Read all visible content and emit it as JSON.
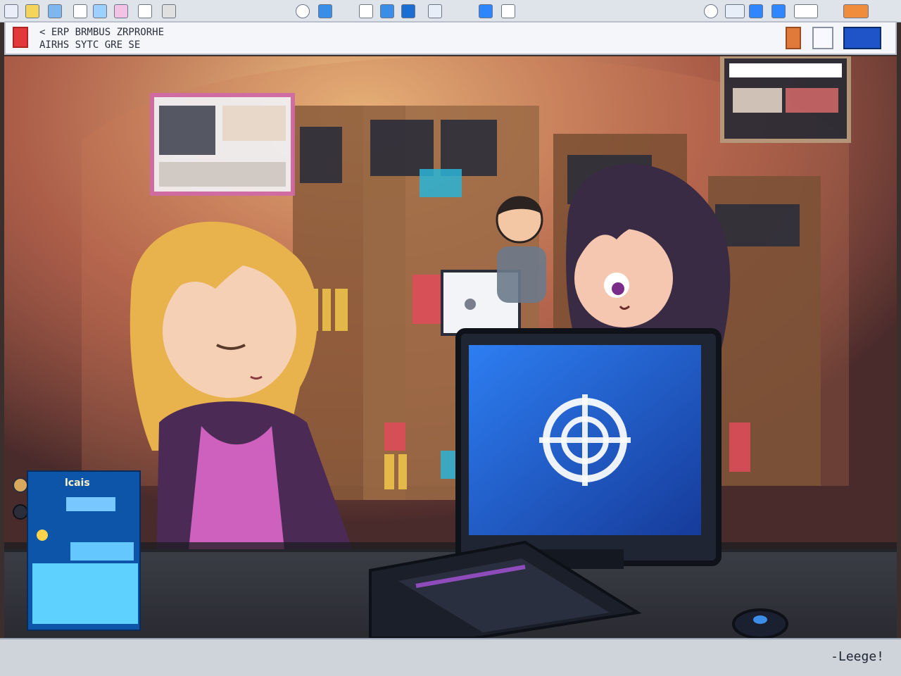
{
  "topbar": {
    "left_icons": [
      "app-icon",
      "folder-icon",
      "image-icon",
      "flag-icon",
      "chart-icon",
      "text-icon",
      "calendar-icon",
      "gear-icon",
      "user-icon",
      "drive-icon",
      "monitor-icon",
      "brush-icon",
      "database-icon",
      "calendar-icon-2",
      "display-icon",
      "pointer-icon"
    ],
    "right_icons": [
      "speaker-icon",
      "keyboard-icon",
      "wifi-icon",
      "battery-icon",
      "clock-icon",
      "notification-icon"
    ]
  },
  "toolbar": {
    "line1": "< ERP BRMBUS ZRPRORHE",
    "line2": "AIRHS SYTC  GRE SE"
  },
  "colors": {
    "room_wall": "#5a3a38",
    "warm_light": "#f0a13a",
    "monitor_glow": "#2a6fe0",
    "panel_blue": "#0d55a8"
  },
  "left_panel": {
    "title": "lcais"
  },
  "status": {
    "text": "-Leege!"
  }
}
